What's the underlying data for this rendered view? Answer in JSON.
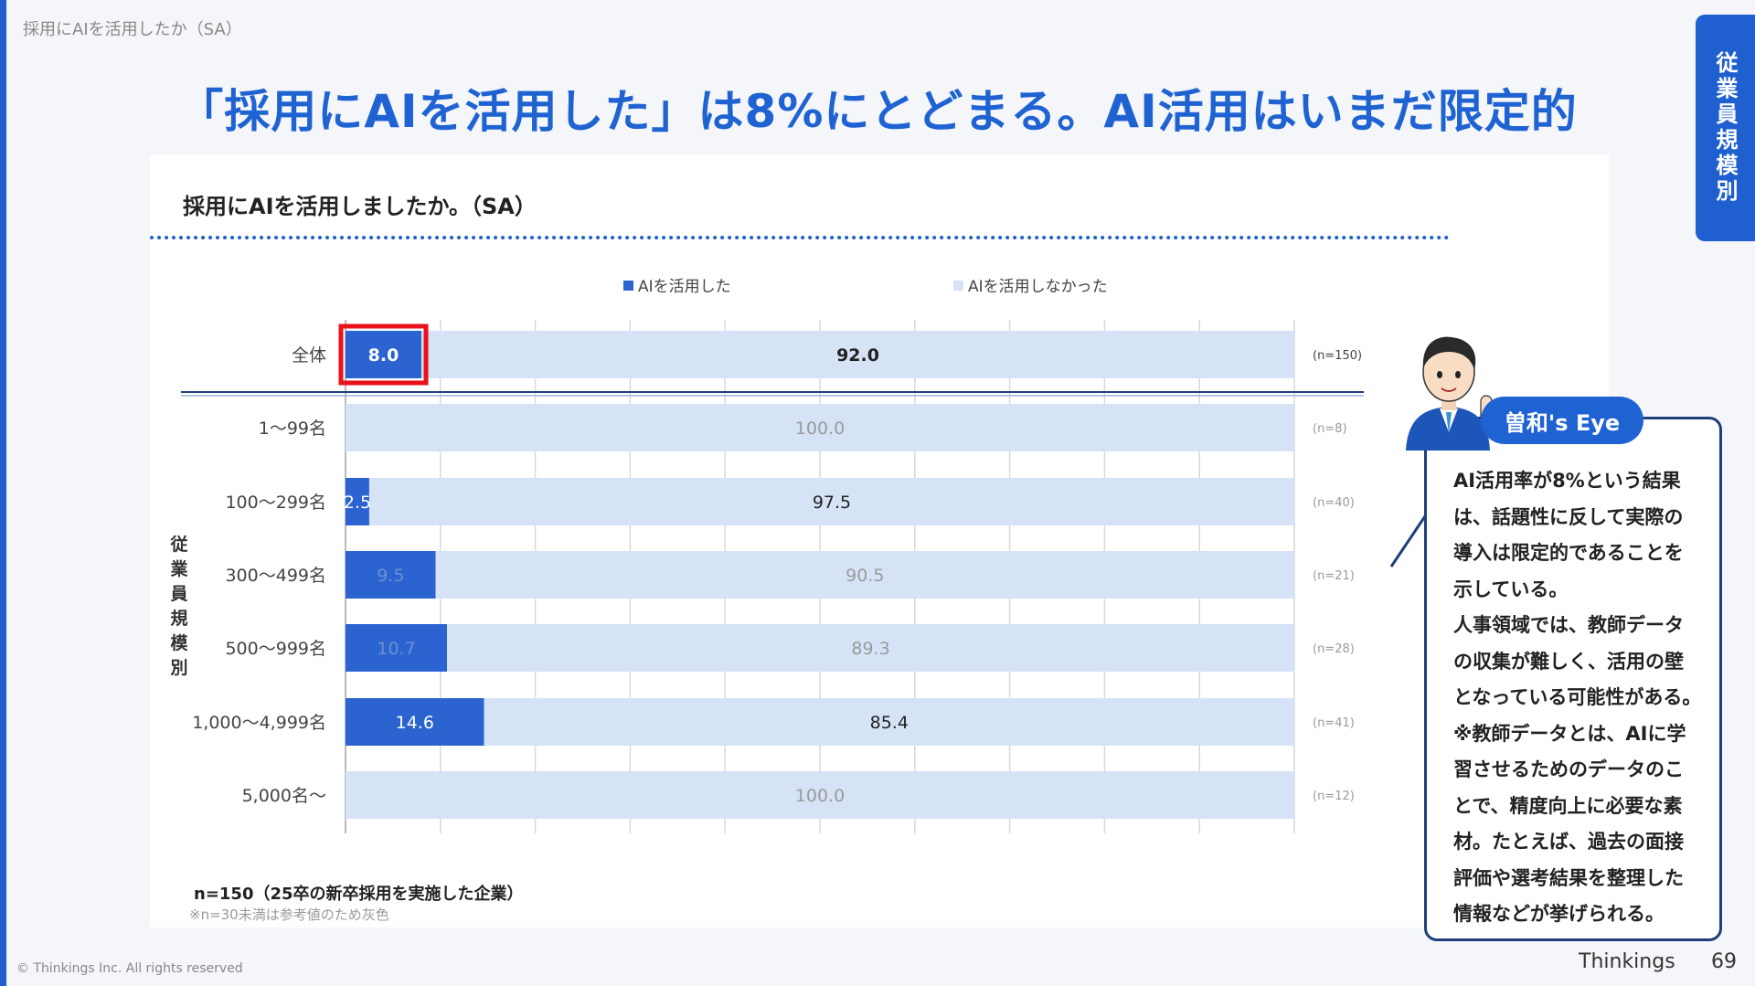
{
  "breadcrumb": "採用にAIを活用したか（SA）",
  "title": "「採用にAIを活用した」は8%にとどまる。AI活用はいまだ限定的",
  "side_tab": "従業員規模別",
  "chart_data": {
    "type": "bar",
    "stacked": true,
    "orientation": "horizontal",
    "title": "採用にAIを活用しましたか。（SA）",
    "categories": [
      "全体",
      "1〜99名",
      "100〜299名",
      "300〜499名",
      "500〜999名",
      "1,000〜4,999名",
      "5,000名〜"
    ],
    "series": [
      {
        "name": "AIを活用した",
        "values": [
          8.0,
          0,
          2.5,
          9.5,
          10.7,
          14.6,
          0
        ],
        "color": "#2b63d1"
      },
      {
        "name": "AIを活用しなかった",
        "values": [
          92.0,
          100.0,
          97.5,
          90.5,
          89.3,
          85.4,
          100.0
        ],
        "color": "#d6e3f7"
      }
    ],
    "data_labels": [
      [
        "8.0",
        "92.0"
      ],
      [
        "",
        "100.0"
      ],
      [
        "2.5",
        "97.5"
      ],
      [
        "9.5",
        "90.5"
      ],
      [
        "10.7",
        "89.3"
      ],
      [
        "14.6",
        "85.4"
      ],
      [
        "",
        "100.0"
      ]
    ],
    "n_labels": [
      "(n=150)",
      "(n=8)",
      "(n=40)",
      "(n=21)",
      "(n=28)",
      "(n=41)",
      "(n=12)"
    ],
    "reference_rows": [
      1,
      3,
      4,
      6
    ],
    "highlight_row": 0,
    "group_label": "従業員規模別",
    "xlim": [
      0,
      100
    ],
    "grid": true,
    "legend_position": "top"
  },
  "footnote": {
    "sample": "n=150（25卒の新卒採用を実施した企業）",
    "note": "※n=30未満は参考値のため灰色"
  },
  "commentary": {
    "badge": "曽和's Eye",
    "text": "AI活用率が8%という結果\nは、話題性に反して実際の\n導入は限定的であることを\n示している。\n人事領域では、教師データ\nの収集が難しく、活用の壁\nとなっている可能性がある。\n※教師データとは、AIに学\n習させるためのデータのこ\nとで、精度向上に必要な素\n材。たとえば、過去の面接\n評価や選考結果を整理した\n情報などが挙げられる。"
  },
  "footer": {
    "copyright": "© Thinkings Inc. All rights reserved",
    "brand": "Thinkings",
    "page_number": "69"
  },
  "colors": {
    "accent": "#1f63d3",
    "highlight_border": "#e8121b",
    "reference_text": "#9a9a9a"
  }
}
